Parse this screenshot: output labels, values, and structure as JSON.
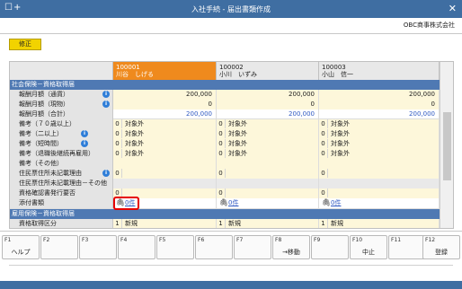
{
  "window": {
    "title": "入社手続 - 届出書類作成",
    "icons": "☐+",
    "close": "✕"
  },
  "company": "OBC商事株式会社",
  "toolbar": {
    "modify_label": "修正"
  },
  "employees": [
    {
      "code": "100001",
      "name": "川谷　しげる"
    },
    {
      "code": "100002",
      "name": "小川　いずみ"
    },
    {
      "code": "100003",
      "name": "小山　信一"
    }
  ],
  "sections": {
    "social": "社会保険－資格取得届",
    "employment": "雇用保険－資格取得届"
  },
  "rows": {
    "remuneration_currency": {
      "label": "報酬月額（通貨）",
      "values": [
        "200,000",
        "200,000",
        "200,000"
      ]
    },
    "remuneration_kind": {
      "label": "報酬月額（現物）",
      "values": [
        "0",
        "0",
        "0"
      ]
    },
    "remuneration_total": {
      "label": "報酬月額（合計）",
      "values": [
        "200,000",
        "200,000",
        "200,000"
      ]
    },
    "note_70": {
      "label": "備考（７０歳以上）",
      "code": "0",
      "text": "対象外"
    },
    "note_two": {
      "label": "備考（二以上）",
      "code": "0",
      "text": "対象外"
    },
    "note_short": {
      "label": "備考（短時間）",
      "code": "0",
      "text": "対象外"
    },
    "note_retire": {
      "label": "備考（退職後継続再雇用）",
      "code": "0",
      "text": "対象外"
    },
    "note_other": {
      "label": "備考（その他）"
    },
    "resident_reason": {
      "label": "住民票住所未記載理由",
      "code": "0"
    },
    "resident_reason_other": {
      "label": "住民票住所未記載理由－その他"
    },
    "qualification_cert": {
      "label": "資格確認書発行要否",
      "code": "0"
    },
    "attachments": {
      "label": "添付書類",
      "values": [
        "0件",
        "0件",
        "0件"
      ]
    },
    "acquisition_type": {
      "label": "資格取得区分",
      "code": "1",
      "text": "新規"
    }
  },
  "function_keys": [
    {
      "key": "F1",
      "label": "ヘルプ"
    },
    {
      "key": "F2",
      "label": ""
    },
    {
      "key": "F3",
      "label": ""
    },
    {
      "key": "F4",
      "label": ""
    },
    {
      "key": "F5",
      "label": ""
    },
    {
      "key": "F6",
      "label": ""
    },
    {
      "key": "F7",
      "label": ""
    },
    {
      "key": "F8",
      "label": "→移動"
    },
    {
      "key": "F9",
      "label": ""
    },
    {
      "key": "F10",
      "label": "中止"
    },
    {
      "key": "F11",
      "label": ""
    },
    {
      "key": "F12",
      "label": "登録"
    }
  ]
}
